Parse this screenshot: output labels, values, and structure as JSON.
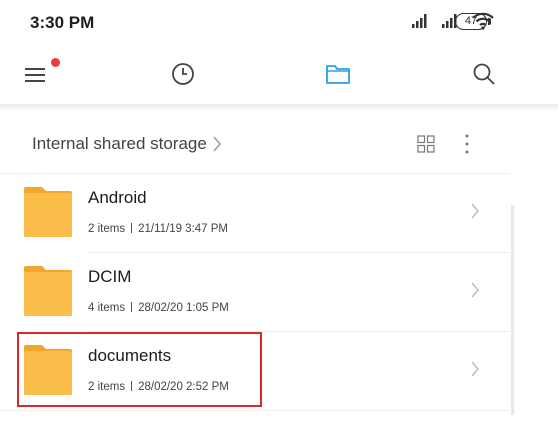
{
  "status_bar": {
    "time": "3:30 PM",
    "battery": "47"
  },
  "toolbar": {
    "menu_icon": "hamburger-menu-icon",
    "recent_icon": "clock-icon",
    "files_icon": "folder-icon",
    "search_icon": "search-icon"
  },
  "breadcrumb": {
    "path": "Internal shared storage"
  },
  "folders": [
    {
      "name": "Android",
      "items": "2 items",
      "date": "21/11/19 3:47 PM"
    },
    {
      "name": "DCIM",
      "items": "4 items",
      "date": "28/02/20 1:05 PM"
    },
    {
      "name": "documents",
      "items": "2 items",
      "date": "28/02/20 2:52 PM"
    }
  ],
  "colors": {
    "folder": "#fbbd4a",
    "folder_tab": "#f4a52c",
    "accent": "#2a9ee8",
    "notification_dot": "#ef3a3a",
    "highlight": "#d9272e"
  }
}
